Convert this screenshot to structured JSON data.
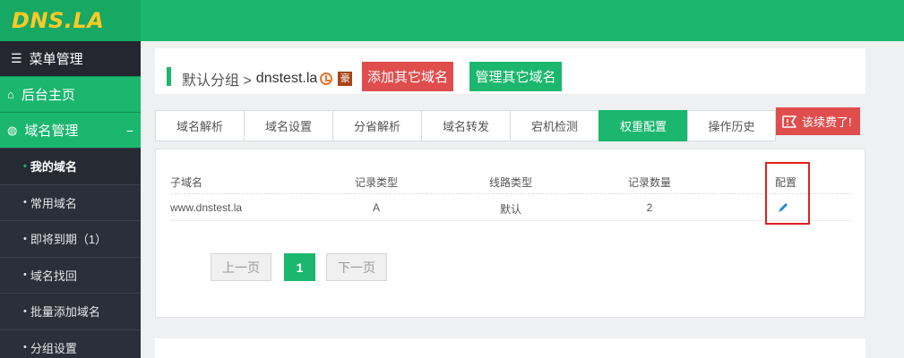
{
  "brand": {
    "logo": "DNS.LA"
  },
  "sidebar": {
    "menu_title": "菜单管理",
    "home": "后台主页",
    "domain_mgmt": "域名管理",
    "collapse_symbol": "−",
    "items": [
      {
        "label": "我的域名"
      },
      {
        "label": "常用域名"
      },
      {
        "label": "即将到期（1）"
      },
      {
        "label": "域名找回"
      },
      {
        "label": "批量添加域名"
      },
      {
        "label": "分组设置"
      }
    ]
  },
  "header": {
    "breadcrumb": "默认分组 >",
    "domain": "dnstest.la",
    "hao_badge": "豪",
    "btn_add_other": "添加其它域名",
    "btn_manage_other": "管理其它域名"
  },
  "tabs": [
    {
      "label": "域名解析"
    },
    {
      "label": "域名设置"
    },
    {
      "label": "分省解析"
    },
    {
      "label": "域名转发"
    },
    {
      "label": "宕机检测"
    },
    {
      "label": "权重配置"
    },
    {
      "label": "操作历史"
    }
  ],
  "active_tab": "权重配置",
  "renew_badge": "该续费了!",
  "table": {
    "headers": [
      "子域名",
      "记录类型",
      "线路类型",
      "记录数量",
      "配置"
    ],
    "rows": [
      {
        "subdomain": "www.dnstest.la",
        "record_type": "A",
        "line_type": "默认",
        "count": "2"
      }
    ]
  },
  "pagination": {
    "prev": "上一页",
    "current": "1",
    "next": "下一页"
  },
  "colors": {
    "brand_green": "#1bb76e",
    "logo_yellow": "#ffc926",
    "danger_red": "#e04d4d",
    "sidebar_dark": "#2b2f3a"
  }
}
